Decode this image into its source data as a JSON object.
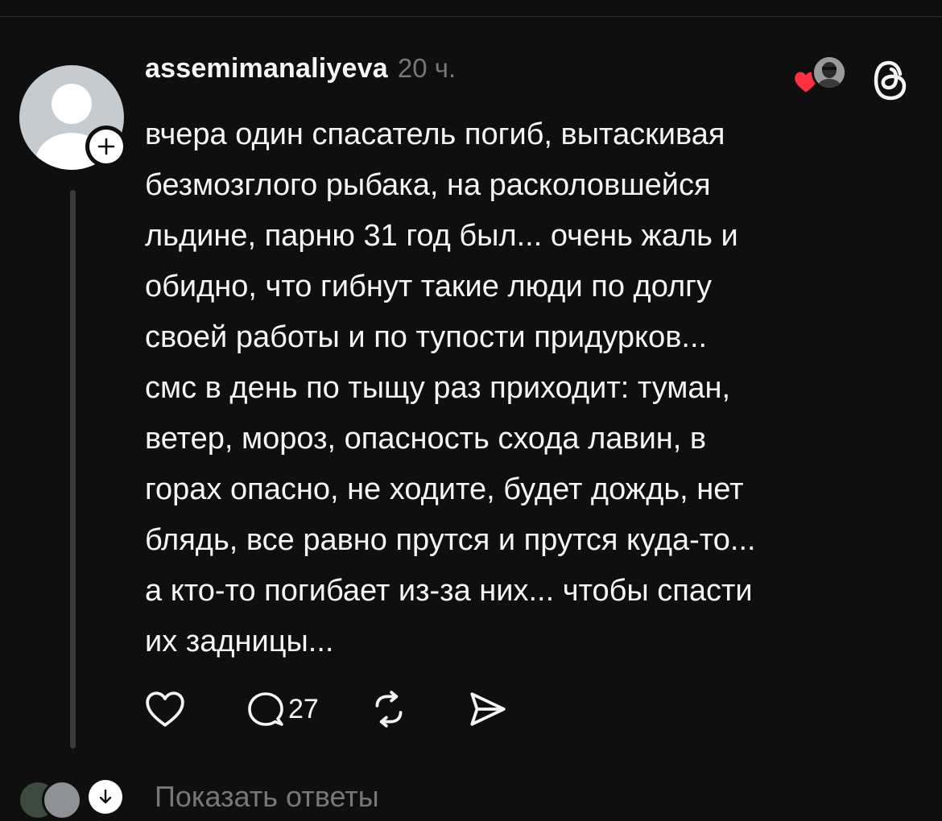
{
  "post": {
    "username": "assemimanaliyeva",
    "timestamp": "20 ч.",
    "body": "вчера один спасатель погиб, вытаскивая\nбезмозглого рыбака, на расколовшейся\nльдине, парню 31 год был... очень жаль и\nобидно, что гибнут такие люди по долгу\nсвоей работы и по тупости придурков...\nсмс в день по тыщу раз приходит: туман,\nветер, мороз, опасность схода лавин, в\nгорах опасно, не ходите, будет дождь, нет\nблядь, все равно прутся и прутся куда-то...\nа кто-то погибает из-за них... чтобы спасти\nих задницы...",
    "comment_count": "27"
  },
  "replies": {
    "show_label": "Показать ответы"
  },
  "icons": {
    "avatar": "default-user-avatar",
    "follow": "plus-icon",
    "liked_by": "heart-icon",
    "app": "threads-logo-icon",
    "like": "heart-outline-icon",
    "comment": "comment-bubble-icon",
    "repost": "repost-icon",
    "share": "send-icon",
    "expand": "arrow-down-icon"
  },
  "colors": {
    "background": "#0f0f0f",
    "text": "#f3f5f7",
    "muted": "#777777",
    "like_red": "#ff3040",
    "thread_line": "#3a3a3a"
  }
}
